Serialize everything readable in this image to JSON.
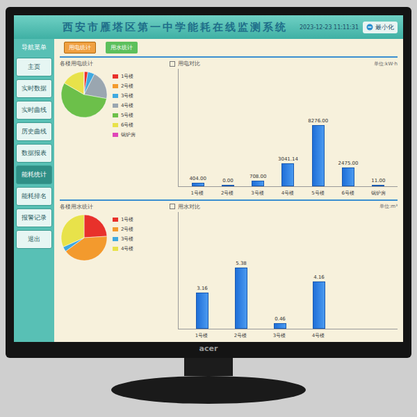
{
  "window": {
    "title": "西安市雁塔区第一中学能耗在线监测系统",
    "datetime": "2023-12-23 11:11:31",
    "minimize": "最小化"
  },
  "monitor": {
    "brand": "acer"
  },
  "sidebar": {
    "header": "导航菜单",
    "items": [
      {
        "label": "主页",
        "selected": false
      },
      {
        "label": "实时数据",
        "selected": false
      },
      {
        "label": "实时曲线",
        "selected": false
      },
      {
        "label": "历史曲线",
        "selected": false
      },
      {
        "label": "数据报表",
        "selected": false
      },
      {
        "label": "能耗统计",
        "selected": true
      },
      {
        "label": "能耗排名",
        "selected": false
      },
      {
        "label": "报警记录",
        "selected": false
      },
      {
        "label": "退出",
        "selected": false
      }
    ]
  },
  "top_buttons": [
    {
      "label": "用电统计",
      "selected": true,
      "color": "#f0a040"
    },
    {
      "label": "用水统计",
      "selected": false,
      "color": "#5cc05c"
    }
  ],
  "panels": [
    {
      "pie_title": "各楼用电统计",
      "bar_title": "用电对比",
      "unit": "单位:kW·h",
      "categories": [
        "1号楼",
        "2号楼",
        "3号楼",
        "4号楼",
        "5号楼",
        "6号楼",
        "锅炉房"
      ],
      "values": [
        404,
        0,
        708,
        3041.14,
        8276,
        2475,
        11
      ],
      "value_labels": [
        "404.00",
        "0.00",
        "708.00",
        "3041.14",
        "8276.00",
        "2475.00",
        "11.00"
      ],
      "legend": [
        {
          "label": "1号楼",
          "color": "#e8312b"
        },
        {
          "label": "2号楼",
          "color": "#f39a2d"
        },
        {
          "label": "3号楼",
          "color": "#3fa9e0"
        },
        {
          "label": "4号楼",
          "color": "#9aa6b0"
        },
        {
          "label": "5号楼",
          "color": "#6cc04a"
        },
        {
          "label": "6号楼",
          "color": "#e8e24a"
        },
        {
          "label": "锅炉房",
          "color": "#e046b8"
        }
      ]
    },
    {
      "pie_title": "各楼用水统计",
      "bar_title": "用水对比",
      "unit": "单位:m³",
      "categories": [
        "1号楼",
        "2号楼",
        "3号楼",
        "4号楼"
      ],
      "values": [
        3.16,
        5.38,
        0.46,
        4.16
      ],
      "value_labels": [
        "3.16",
        "5.38",
        "0.46",
        "4.16"
      ],
      "legend": [
        {
          "label": "1号楼",
          "color": "#e8312b"
        },
        {
          "label": "2号楼",
          "color": "#f39a2d"
        },
        {
          "label": "3号楼",
          "color": "#3fa9e0"
        },
        {
          "label": "4号楼",
          "color": "#e8e24a"
        }
      ]
    }
  ]
}
